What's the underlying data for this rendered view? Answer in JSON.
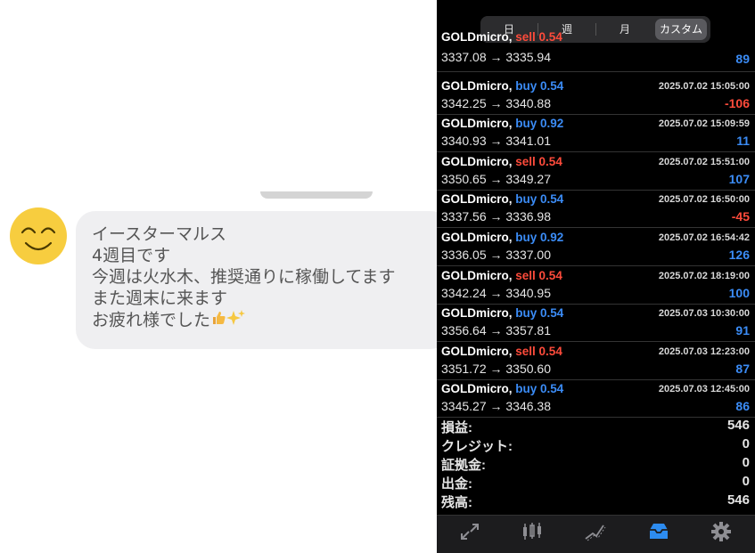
{
  "chat": {
    "lines": [
      "イースターマルス",
      "4週目です",
      "今週は火水木、推奨通りに稼働してます",
      "また週末に来ます",
      "お疲れ様でした"
    ],
    "emojis": [
      "thumbs-up-icon",
      "sparkles-icon"
    ]
  },
  "segments": [
    "日",
    "週",
    "月",
    "カスタム"
  ],
  "active_segment": "カスタム",
  "trades": [
    {
      "symbol": "GOLDmicro,",
      "side": "sell",
      "lots": "sell 0.54",
      "time": "",
      "prices": "3337.08 → 3335.94",
      "pl": "89"
    },
    {
      "symbol": "GOLDmicro,",
      "side": "buy",
      "lots": "buy 0.54",
      "time": "2025.07.02 15:05:00",
      "prices": "3342.25 → 3340.88",
      "pl": "-106"
    },
    {
      "symbol": "GOLDmicro,",
      "side": "buy",
      "lots": "buy 0.92",
      "time": "2025.07.02 15:09:59",
      "prices": "3340.93 → 3341.01",
      "pl": "11"
    },
    {
      "symbol": "GOLDmicro,",
      "side": "sell",
      "lots": "sell 0.54",
      "time": "2025.07.02 15:51:00",
      "prices": "3350.65 → 3349.27",
      "pl": "107"
    },
    {
      "symbol": "GOLDmicro,",
      "side": "buy",
      "lots": "buy 0.54",
      "time": "2025.07.02 16:50:00",
      "prices": "3337.56 → 3336.98",
      "pl": "-45"
    },
    {
      "symbol": "GOLDmicro,",
      "side": "buy",
      "lots": "buy 0.92",
      "time": "2025.07.02 16:54:42",
      "prices": "3336.05 → 3337.00",
      "pl": "126"
    },
    {
      "symbol": "GOLDmicro,",
      "side": "sell",
      "lots": "sell 0.54",
      "time": "2025.07.02 18:19:00",
      "prices": "3342.24 → 3340.95",
      "pl": "100"
    },
    {
      "symbol": "GOLDmicro,",
      "side": "buy",
      "lots": "buy 0.54",
      "time": "2025.07.03 10:30:00",
      "prices": "3356.64 → 3357.81",
      "pl": "91"
    },
    {
      "symbol": "GOLDmicro,",
      "side": "sell",
      "lots": "sell 0.54",
      "time": "2025.07.03 12:23:00",
      "prices": "3351.72 → 3350.60",
      "pl": "87"
    },
    {
      "symbol": "GOLDmicro,",
      "side": "buy",
      "lots": "buy 0.54",
      "time": "2025.07.03 12:45:00",
      "prices": "3345.27 → 3346.38",
      "pl": "86"
    }
  ],
  "summary": [
    {
      "label": "損益:",
      "value": "546"
    },
    {
      "label": "クレジット:",
      "value": "0"
    },
    {
      "label": "証拠金:",
      "value": "0"
    },
    {
      "label": "出金:",
      "value": "0"
    },
    {
      "label": "残高:",
      "value": "546"
    }
  ],
  "tabs": [
    {
      "icon": "trade-icon"
    },
    {
      "icon": "chart-icon"
    },
    {
      "icon": "trend-icon"
    },
    {
      "icon": "history-icon",
      "active": true
    },
    {
      "icon": "settings-icon"
    }
  ],
  "colors": {
    "buy": "#3b8cf6",
    "sell": "#ff4b3b",
    "accent": "#2d8cf0",
    "bubble": "#efeff1",
    "avatar": "#f7cd3f"
  }
}
